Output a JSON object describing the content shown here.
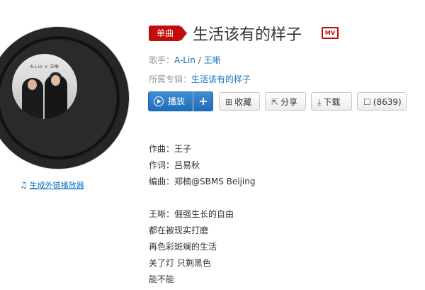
{
  "album_cover": {
    "title": "A-Lin × 王晰"
  },
  "generate_link": {
    "label": "生成外链播放器"
  },
  "song": {
    "tag": "单曲",
    "title": "生活该有的样子",
    "mv_label": "MV"
  },
  "singer": {
    "label": "歌手：",
    "artists": [
      "A-Lin",
      "王晰"
    ],
    "separator": " / "
  },
  "album": {
    "label": "所属专辑：",
    "name": "生活该有的样子"
  },
  "actions": {
    "play": "播放",
    "add": "+",
    "collect": "收藏",
    "share": "分享",
    "download": "下载",
    "comment": "(8639)"
  },
  "lyrics": [
    "作曲：王子",
    "作词：吕易秋",
    "编曲：郑楠@SBMS Beijing",
    "",
    "王晰：倔强生长的自由",
    "都在被现实打磨",
    "再色彩斑斓的生活",
    "关了灯 只剩黑色",
    "能不能"
  ],
  "colors": {
    "accent_red": "#c20c0c",
    "link_blue": "#0c73c2",
    "play_blue": "#2a7bc6"
  }
}
